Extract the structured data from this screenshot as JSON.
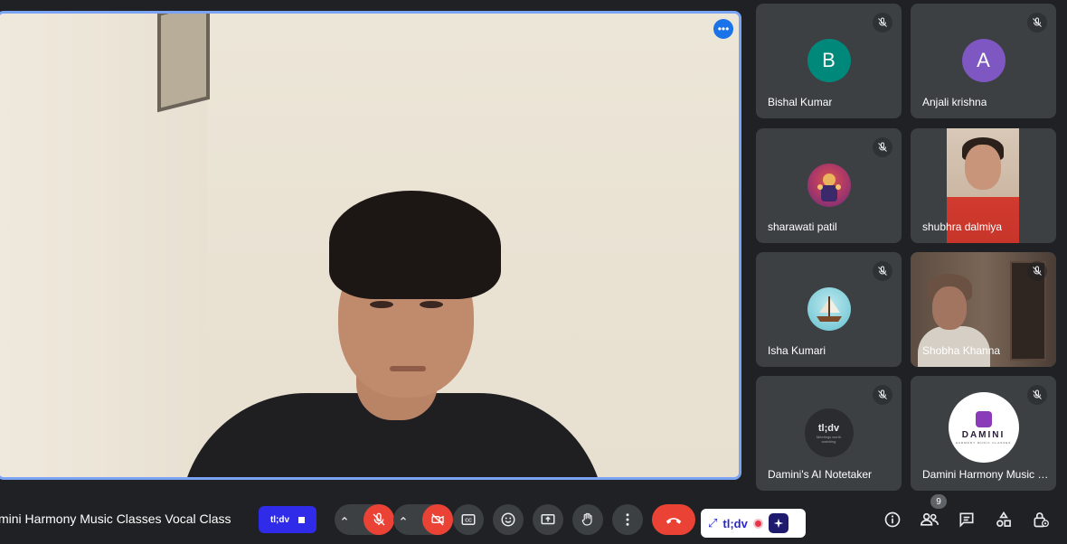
{
  "meeting": {
    "title": "mini Harmony Music Classes Vocal Class",
    "people_count": "9"
  },
  "main_video": {
    "more_options_glyph": "•••"
  },
  "participants": [
    {
      "name": "Bishal Kumar",
      "initial": "B",
      "avatar_color": "#00897b",
      "muted": true
    },
    {
      "name": "Anjali krishna",
      "initial": "A",
      "avatar_color": "#7e57c2",
      "muted": true
    },
    {
      "name": "sharawati patil",
      "muted": true
    },
    {
      "name": "shubhra dalmiya",
      "muted": true
    },
    {
      "name": "Isha Kumari",
      "muted": true
    },
    {
      "name": "Shobha Khanna",
      "muted": true
    },
    {
      "name": "Damini's AI Notetaker",
      "muted": true
    },
    {
      "name": "Damini Harmony Music Classes",
      "muted": true
    }
  ],
  "notetaker_avatar": {
    "title": "tl;dv",
    "tagline": "Meetings worth watching"
  },
  "damini_logo": {
    "word": "DAMINI",
    "sub": "HARMONY MUSIC CLASSES"
  },
  "recorder": {
    "label": "tl;dv"
  },
  "tldv_widget": {
    "brand": "tl;dv",
    "expand_glyph": "⤢"
  },
  "colors": {
    "background": "#202124",
    "tile": "#3c4043",
    "danger": "#ea4335",
    "active_speaker_border": "#7ba3f4",
    "accent": "#1a73e8",
    "tldv_blue": "#2f2be8"
  },
  "icons": {
    "mic": "mic-off-icon",
    "camera": "camera-off-icon",
    "captions": "closed-captions-icon",
    "emoji": "emoji-icon",
    "present": "present-screen-icon",
    "raise_hand": "raise-hand-icon",
    "more": "more-vert-icon",
    "end_call": "end-call-icon",
    "info": "info-icon",
    "people": "people-icon",
    "chat": "chat-icon",
    "activities": "activities-icon",
    "host_controls": "host-controls-icon"
  }
}
